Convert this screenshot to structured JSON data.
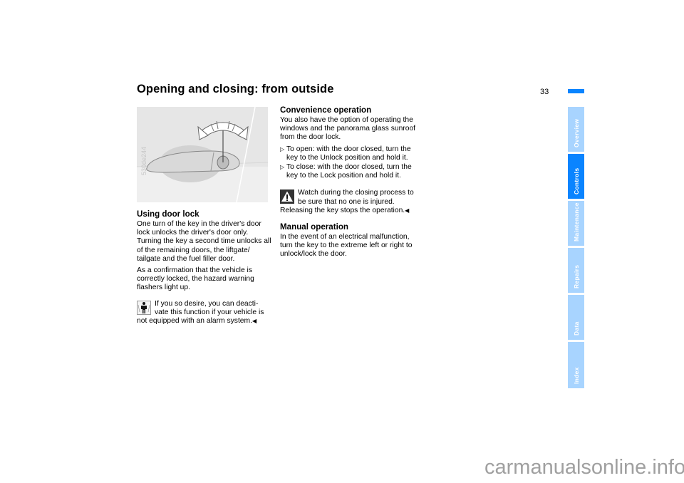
{
  "header": {
    "title": "Opening and closing: from outside",
    "page_number": "33",
    "accent_color": "#0a84ff"
  },
  "figure": {
    "code": "530de244",
    "description": "door-handle-with-key-rotation-illustration"
  },
  "sections": {
    "door_lock": {
      "heading": "Using door lock",
      "paragraphs": [
        "One turn of the key in the driver's door lock unlocks the driver's door only. Turning the key a second time unlocks all of the remaining doors, the liftgate/ tailgate and the fuel filler door.",
        "As a confirmation that the vehicle is correctly locked, the hazard warning flashers light up."
      ],
      "note": "If you so desire, you can deacti- vate this function if your vehicle is not equipped with an alarm system."
    },
    "convenience": {
      "heading": "Convenience operation",
      "intro": "You also have the option of operating the windows and the panorama glass sunroof from the door lock.",
      "bullets": [
        "To open: with the door closed, turn the key to the Unlock position and hold it.",
        "To close: with the door closed, turn the key to the Lock position and hold it."
      ],
      "warning": "Watch during the closing process to be sure that no one is injured. Releasing the key stops the operation."
    },
    "manual": {
      "heading": "Manual operation",
      "text": "In the event of an electrical malfunction, turn the key to the extreme left or right to unlock/lock the door."
    }
  },
  "end_mark": "◀",
  "bullet_mark": "▷",
  "side_tabs": [
    {
      "label": "Overview",
      "active": false
    },
    {
      "label": "Controls",
      "active": true
    },
    {
      "label": "Maintenance",
      "active": false
    },
    {
      "label": "Repairs",
      "active": false
    },
    {
      "label": "Data",
      "active": false
    },
    {
      "label": "Index",
      "active": false
    }
  ],
  "watermark": "carmanualsonline.info"
}
